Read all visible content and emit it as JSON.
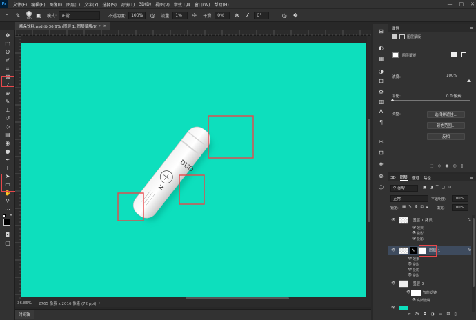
{
  "menu": {
    "logo": "Ps",
    "items": [
      "文件(F)",
      "编辑(E)",
      "图像(I)",
      "图层(L)",
      "文字(Y)",
      "选择(S)",
      "滤镜(T)",
      "3D(D)",
      "视图(V)",
      "增效工具",
      "窗口(W)",
      "帮助(H)"
    ],
    "window_controls": [
      "—",
      "□",
      "✕"
    ]
  },
  "options": {
    "brush_size": "145",
    "mode_label": "模式:",
    "mode_value": "正常",
    "opacity_label": "不透明度:",
    "opacity_value": "100%",
    "flow_label": "流量:",
    "flow_value": "1%",
    "smooth_label": "平滑:",
    "smooth_value": "0%",
    "angle_value": "0°"
  },
  "document": {
    "tab_title": "瓶朵饮料.psd @ 36.9% (图层 1, 图层蒙版/8) *",
    "tab_close": "×"
  },
  "status": {
    "zoom": "36.86%",
    "info": "2765 像素 x 2016 像素 (72 ppi)",
    "timeline": "时间轴"
  },
  "canvas": {
    "bg_color": "#0ddfbd",
    "highlight_color": "#e8474a",
    "product_text_1": "DUO",
    "product_text_2": "N"
  },
  "properties": {
    "title": "属性",
    "mask_label": "图层蒙版",
    "density_label": "浓度:",
    "density_value": "100%",
    "feather_label": "羽化:",
    "feather_value": "0.0 像素",
    "adjust_label": "调整:",
    "btn_select_mask": "选择并遮住...",
    "btn_color_range": "颜色范围...",
    "btn_invert": "反相"
  },
  "layers": {
    "tabs": [
      "3D",
      "图层",
      "通道",
      "路径"
    ],
    "filter_label": "类型",
    "blend_mode": "正常",
    "opacity_label": "不透明度:",
    "opacity_value": "100%",
    "lock_label": "锁定:",
    "fill_label": "填充:",
    "fill_value": "100%",
    "rows": [
      {
        "name": "图层 1 拷贝",
        "fx": "fx"
      },
      {
        "name": "图层 1",
        "fx": "fx"
      },
      {
        "name": "图层 3",
        "fx": ""
      }
    ],
    "effects_label": "效果",
    "effect_items": [
      "投影",
      "投影"
    ],
    "effect_items_2": [
      "投影",
      "投影",
      "投影"
    ],
    "smart_filters": "智能滤镜",
    "gaussian_blur": "高斯模糊"
  }
}
